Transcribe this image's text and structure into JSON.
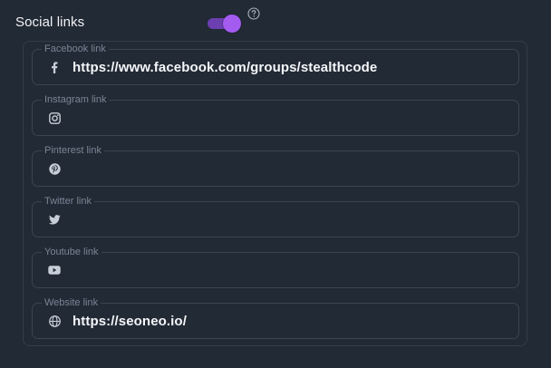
{
  "section": {
    "title": "Social links",
    "toggle_on": true,
    "accent": "#a35bf0"
  },
  "fields": [
    {
      "key": "facebook",
      "legend": "Facebook link",
      "icon": "facebook-icon",
      "value": "https://www.facebook.com/groups/stealthcode",
      "placeholder": ""
    },
    {
      "key": "instagram",
      "legend": "Instagram link",
      "icon": "instagram-icon",
      "value": "",
      "placeholder": ""
    },
    {
      "key": "pinterest",
      "legend": "Pinterest link",
      "icon": "pinterest-icon",
      "value": "",
      "placeholder": ""
    },
    {
      "key": "twitter",
      "legend": "Twitter link",
      "icon": "twitter-icon",
      "value": "",
      "placeholder": ""
    },
    {
      "key": "youtube",
      "legend": "Youtube link",
      "icon": "youtube-icon",
      "value": "",
      "placeholder": ""
    },
    {
      "key": "website",
      "legend": "Website link",
      "icon": "globe-icon",
      "value": "https://seoneo.io/",
      "placeholder": ""
    }
  ]
}
